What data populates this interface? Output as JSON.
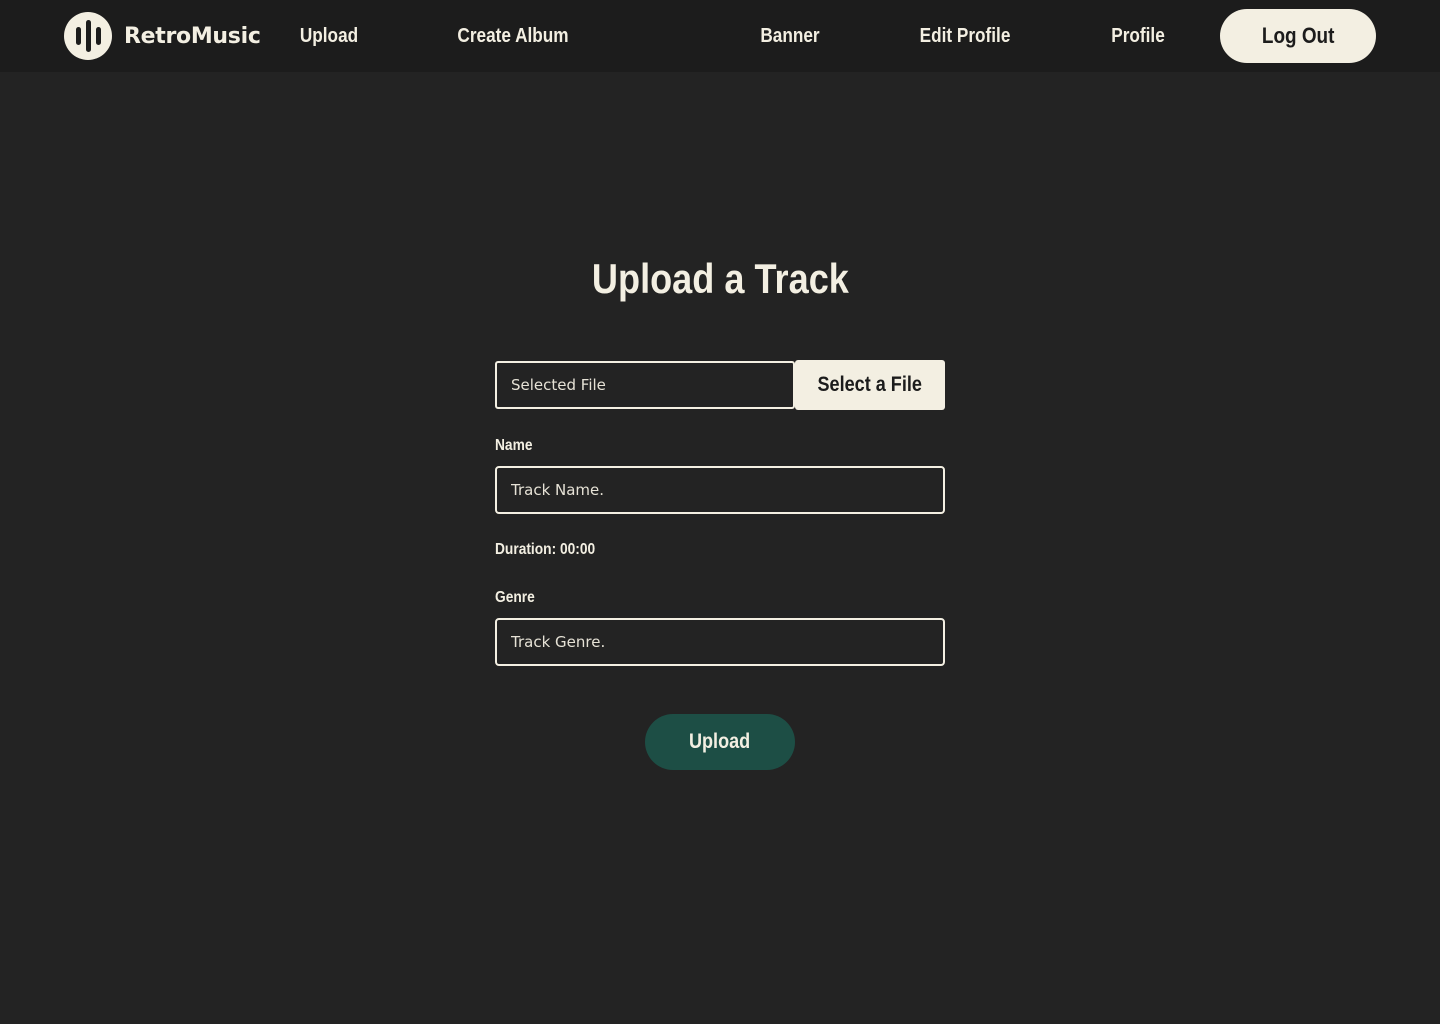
{
  "navbar": {
    "brand": "RetroMusic",
    "links": {
      "upload": "Upload",
      "create_album": "Create Album",
      "banner": "Banner",
      "edit_profile": "Edit Profile",
      "profile": "Profile"
    },
    "logout_label": "Log Out"
  },
  "form": {
    "title": "Upload a Track",
    "file": {
      "value": "Selected File",
      "button_label": "Select a File"
    },
    "name": {
      "label": "Name",
      "placeholder": "Track Name."
    },
    "duration": {
      "label": "Duration: 00:00"
    },
    "genre": {
      "label": "Genre",
      "placeholder": "Track Genre."
    },
    "submit_label": "Upload"
  },
  "colors": {
    "background": "#232323",
    "navbar": "#1c1c1c",
    "cream": "#f3efe2",
    "accent_green": "#1d4e45"
  }
}
